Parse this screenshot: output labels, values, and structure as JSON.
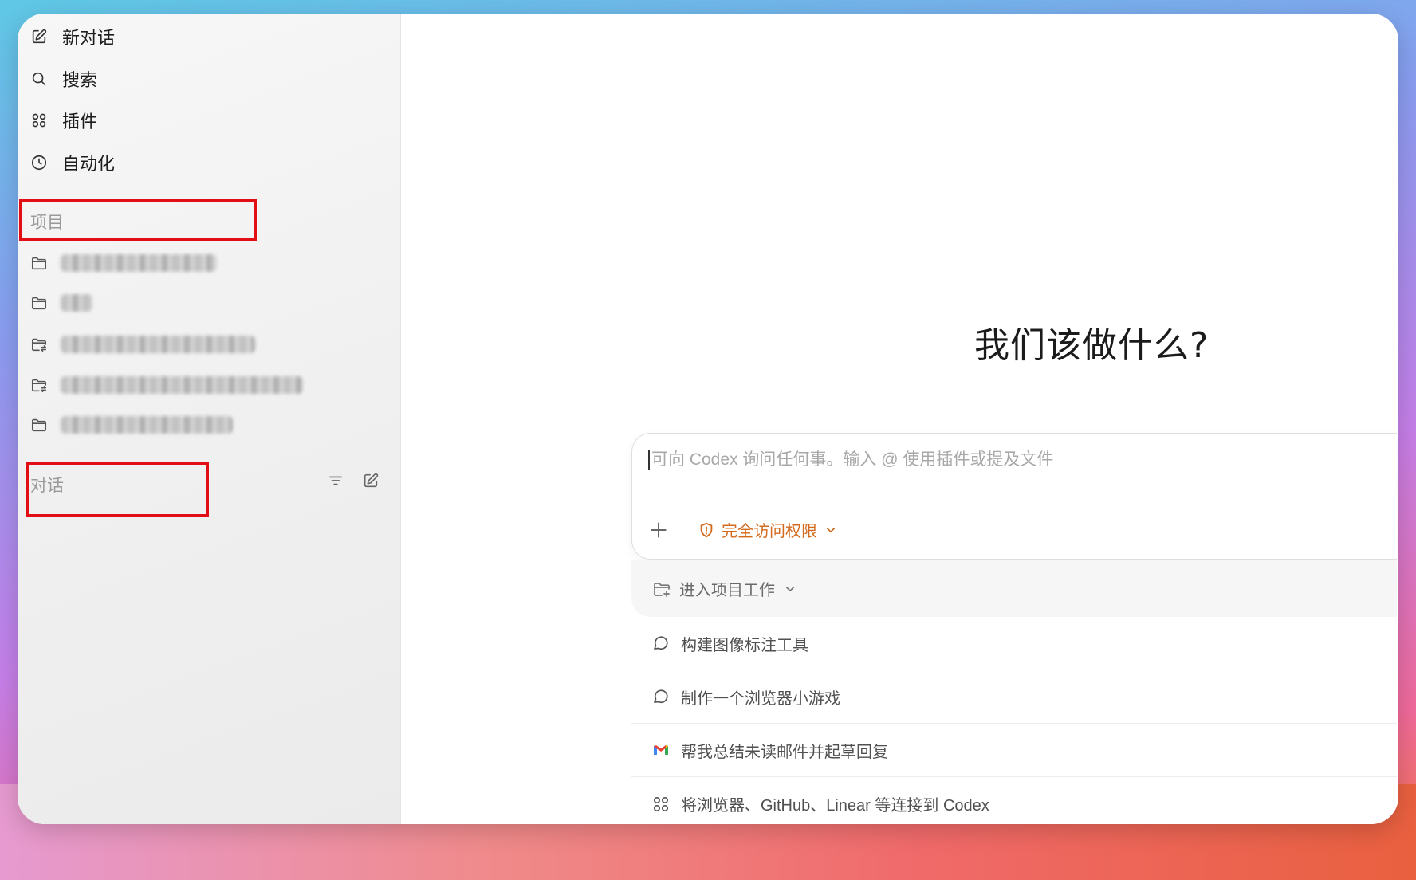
{
  "sidebar": {
    "nav": [
      {
        "label": "新对话",
        "icon": "edit-icon"
      },
      {
        "label": "搜索",
        "icon": "search-icon"
      },
      {
        "label": "插件",
        "icon": "grid-icon"
      },
      {
        "label": "自动化",
        "icon": "clock-icon"
      }
    ],
    "projects_label": "项目",
    "projects": [
      {
        "icon": "folder-icon"
      },
      {
        "icon": "folder-icon"
      },
      {
        "icon": "folder-sync-icon"
      },
      {
        "icon": "folder-sync-icon"
      },
      {
        "icon": "folder-icon"
      }
    ],
    "conversations_label": "对话",
    "highlight_color": "#e30d15"
  },
  "main": {
    "headline": "我们该做什么?",
    "composer": {
      "placeholder": "可向 Codex 询问任何事。输入 @ 使用插件或提及文件",
      "access_label": "完全访问权限",
      "access_color": "#d46a1d",
      "enter_project_label": "进入项目工作"
    },
    "suggestions": [
      {
        "label": "构建图像标注工具",
        "icon": "chat-bubble-icon"
      },
      {
        "label": "制作一个浏览器小游戏",
        "icon": "chat-bubble-icon"
      },
      {
        "label": "帮我总结未读邮件并起草回复",
        "icon": "gmail-icon"
      },
      {
        "label": "将浏览器、GitHub、Linear 等连接到 Codex",
        "icon": "grid-icon"
      }
    ]
  }
}
